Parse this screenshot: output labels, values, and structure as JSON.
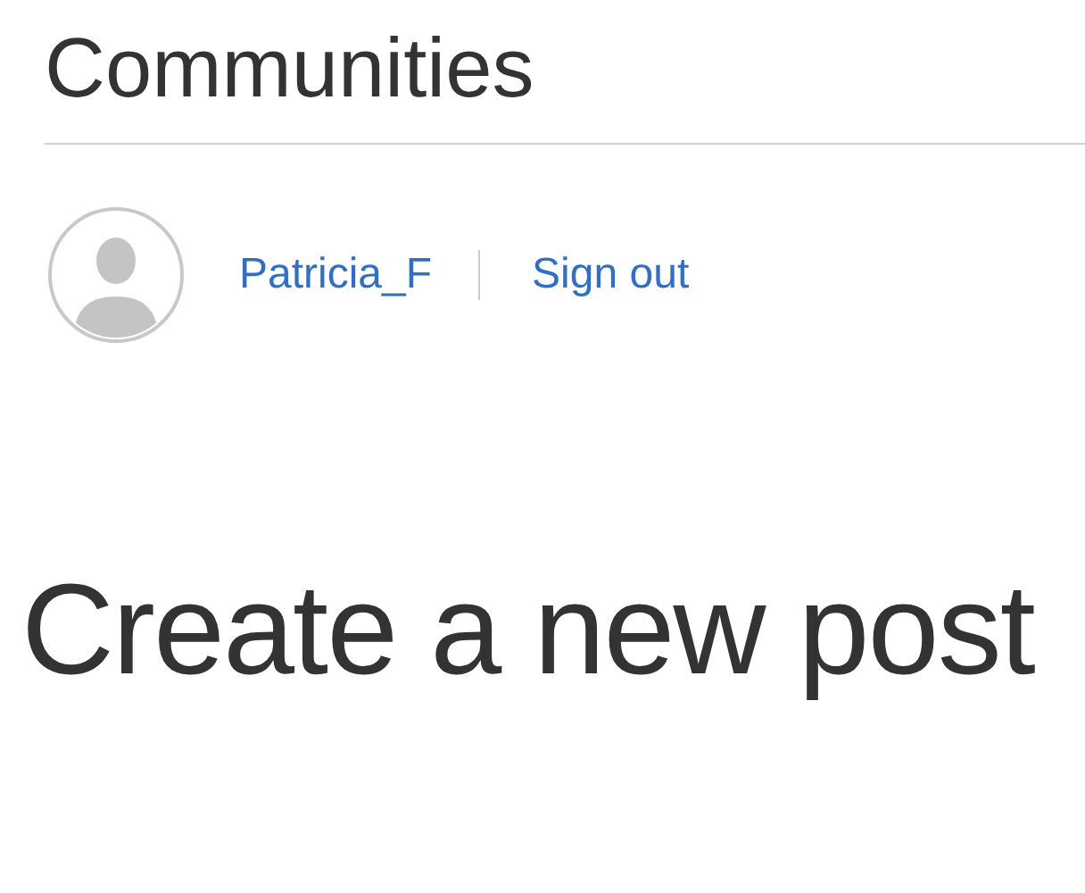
{
  "header": {
    "title": "Communities"
  },
  "user": {
    "name": "Patricia_F",
    "sign_out": "Sign out"
  },
  "page": {
    "heading": "Create a new post"
  }
}
